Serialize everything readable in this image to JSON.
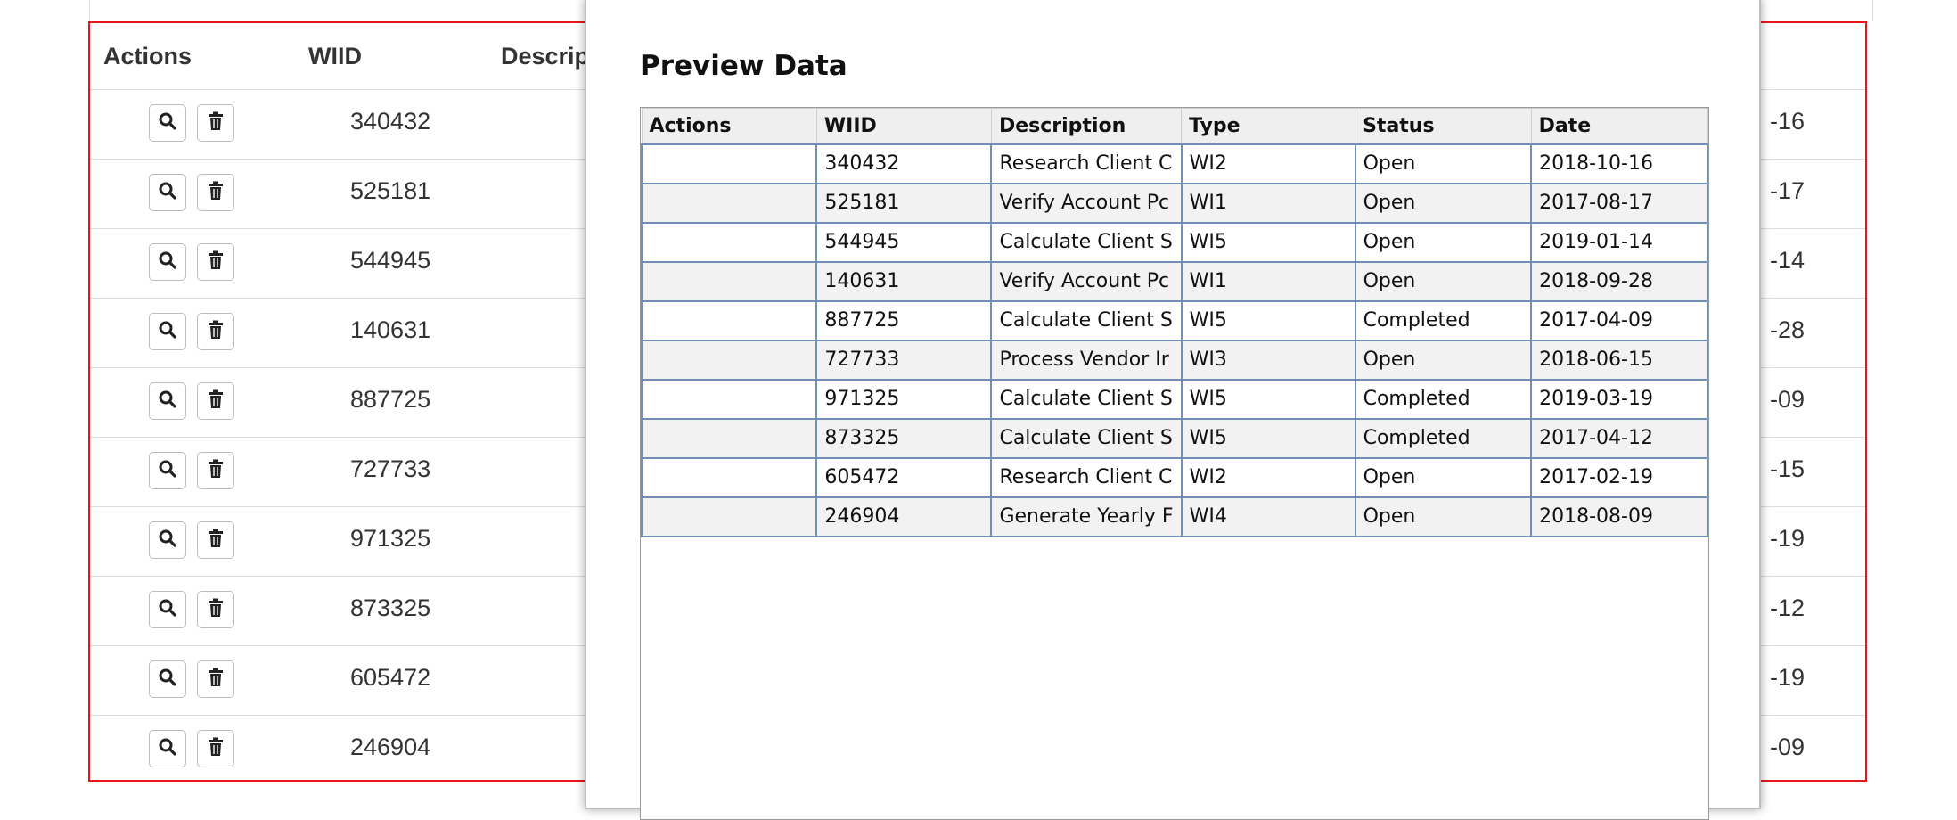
{
  "background_table": {
    "headers": {
      "actions": "Actions",
      "wiid": "WIID",
      "description": "Descrip"
    },
    "rows": [
      {
        "wiid": "340432",
        "date_tail": "-16"
      },
      {
        "wiid": "525181",
        "date_tail": "-17"
      },
      {
        "wiid": "544945",
        "date_tail": "-14"
      },
      {
        "wiid": "140631",
        "date_tail": "-28"
      },
      {
        "wiid": "887725",
        "date_tail": "-09"
      },
      {
        "wiid": "727733",
        "date_tail": "-15"
      },
      {
        "wiid": "971325",
        "date_tail": "-19"
      },
      {
        "wiid": "873325",
        "date_tail": "-12"
      },
      {
        "wiid": "605472",
        "date_tail": "-19"
      },
      {
        "wiid": "246904",
        "date_tail": "-09"
      }
    ]
  },
  "modal": {
    "title": "Preview Data",
    "columns": [
      "Actions",
      "WIID",
      "Description",
      "Type",
      "Status",
      "Date"
    ],
    "rows": [
      {
        "actions": "",
        "wiid": "340432",
        "description": "Research Client C",
        "type": "WI2",
        "status": "Open",
        "date": "2018-10-16"
      },
      {
        "actions": "",
        "wiid": "525181",
        "description": "Verify Account Pc",
        "type": "WI1",
        "status": "Open",
        "date": "2017-08-17"
      },
      {
        "actions": "",
        "wiid": "544945",
        "description": "Calculate Client S",
        "type": "WI5",
        "status": "Open",
        "date": "2019-01-14"
      },
      {
        "actions": "",
        "wiid": "140631",
        "description": "Verify Account Pc",
        "type": "WI1",
        "status": "Open",
        "date": "2018-09-28"
      },
      {
        "actions": "",
        "wiid": "887725",
        "description": "Calculate Client S",
        "type": "WI5",
        "status": "Completed",
        "date": "2017-04-09"
      },
      {
        "actions": "",
        "wiid": "727733",
        "description": "Process Vendor Ir",
        "type": "WI3",
        "status": "Open",
        "date": "2018-06-15"
      },
      {
        "actions": "",
        "wiid": "971325",
        "description": "Calculate Client S",
        "type": "WI5",
        "status": "Completed",
        "date": "2019-03-19"
      },
      {
        "actions": "",
        "wiid": "873325",
        "description": "Calculate Client S",
        "type": "WI5",
        "status": "Completed",
        "date": "2017-04-12"
      },
      {
        "actions": "",
        "wiid": "605472",
        "description": "Research Client C",
        "type": "WI2",
        "status": "Open",
        "date": "2017-02-19"
      },
      {
        "actions": "",
        "wiid": "246904",
        "description": "Generate Yearly F",
        "type": "WI4",
        "status": "Open",
        "date": "2018-08-09"
      }
    ]
  },
  "icons": {
    "search": "search-icon",
    "trash": "trash-icon"
  },
  "colors": {
    "frame": "#e5161c",
    "grid_border": "#6f8fb5",
    "header_bg": "#efefef",
    "alt_row": "#f2f2f2"
  }
}
